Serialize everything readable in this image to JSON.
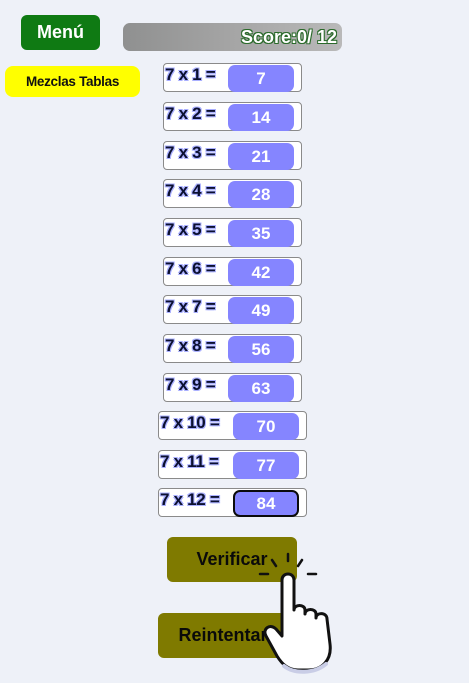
{
  "header": {
    "menu_label": "Menú",
    "mix_label": "Mezclas Tablas",
    "score_label": "Score:0/ 12"
  },
  "table": {
    "rows": [
      {
        "equation": "7 x 1 =",
        "answer": "7"
      },
      {
        "equation": "7 x 2 =",
        "answer": "14"
      },
      {
        "equation": "7 x 3 =",
        "answer": "21"
      },
      {
        "equation": "7 x 4 =",
        "answer": "28"
      },
      {
        "equation": "7 x 5 =",
        "answer": "35"
      },
      {
        "equation": "7 x 6 =",
        "answer": "42"
      },
      {
        "equation": "7 x 7 =",
        "answer": "49"
      },
      {
        "equation": "7 x 8 =",
        "answer": "56"
      },
      {
        "equation": "7 x 9 =",
        "answer": "63"
      },
      {
        "equation": "7 x 10 =",
        "answer": "70"
      },
      {
        "equation": "7 x 11 =",
        "answer": "77"
      },
      {
        "equation": "7 x 12 =",
        "answer": "84"
      }
    ]
  },
  "actions": {
    "verify_label": "Verificar",
    "retry_label": "Reintentar"
  },
  "colors": {
    "menu": "#0f7a13",
    "mix": "#ffff00",
    "answer": "#8585ff",
    "action": "#7f7a00"
  },
  "cursor": {
    "icon": "hand-pointer-icon"
  }
}
